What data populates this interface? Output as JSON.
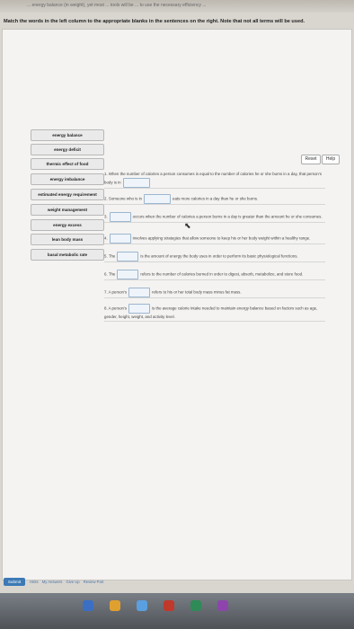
{
  "header": {
    "top_text": "... energy balance (in weight), yet most ... tools will be ... to use the necessary efficiency ..."
  },
  "instruction": "Match the words in the left column to the appropriate blanks in the sentences on the right. Note that not all terms will be used.",
  "toolbar": {
    "reset_label": "Reset",
    "help_label": "Help"
  },
  "terms": [
    "energy balance",
    "energy deficit",
    "thermic effect of food",
    "energy imbalance",
    "estimated energy requirement",
    "weight management",
    "energy excess",
    "lean body mass",
    "basal metabolic rate"
  ],
  "sentences": [
    {
      "num": "1.",
      "pre": "When the number of calories a person consumes is equal to the number of calories he or she burns in a day, that person's body is in",
      "post": ""
    },
    {
      "num": "2.",
      "pre": "Someone who is in",
      "post": "eats more calories in a day than he or she burns."
    },
    {
      "num": "3.",
      "pre": "",
      "post": "occurs when the number of calories a person burns in a day is greater than the amount he or she consumes."
    },
    {
      "num": "4.",
      "pre": "",
      "post": "involves applying strategies that allow someone to keep his or her body weight within a healthy range."
    },
    {
      "num": "5.",
      "pre": "The",
      "post": "is the amount of energy the body uses in order to perform its basic physiological functions."
    },
    {
      "num": "6.",
      "pre": "The",
      "post": "refers to the number of calories burned in order to digest, absorb, metabolize, and store food."
    },
    {
      "num": "7.",
      "pre": "A person's",
      "post": "refers to his or her total body mass minus fat mass."
    },
    {
      "num": "8.",
      "pre": "A person's",
      "post": "is the average calorie intake needed to maintain energy balance based on factors such as age, gender, height, weight, and activity level."
    }
  ],
  "footer": {
    "submit_label": "Submit",
    "links": [
      "Hints",
      "My Answers",
      "Give Up",
      "Review Part"
    ]
  }
}
